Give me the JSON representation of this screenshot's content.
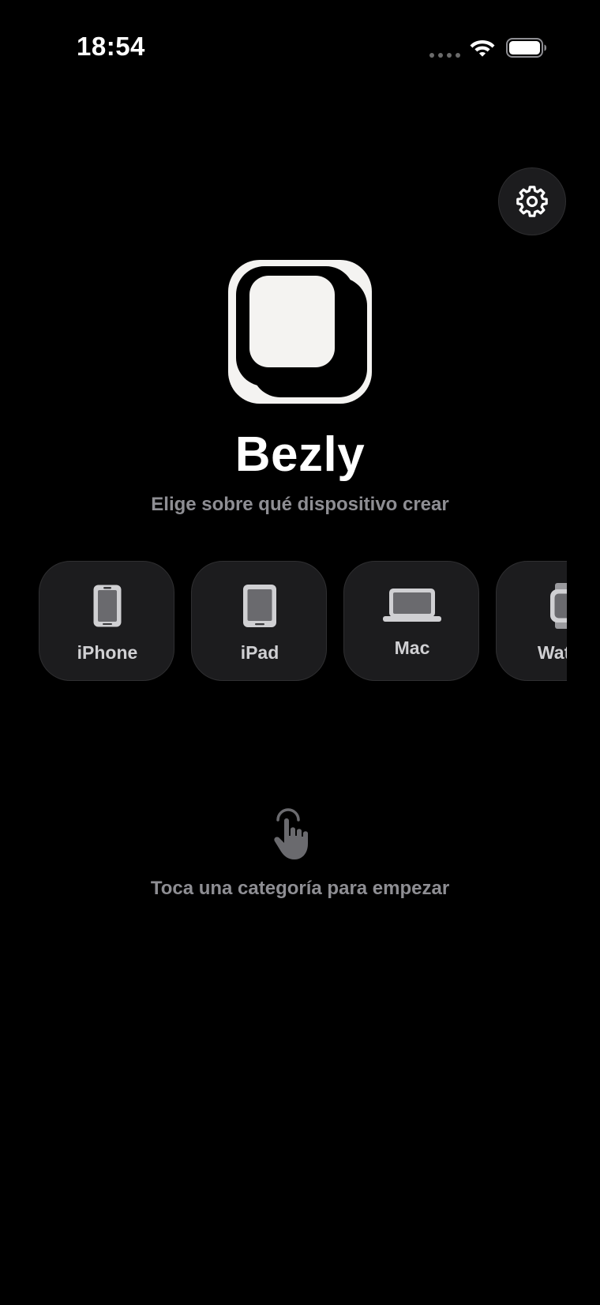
{
  "status_bar": {
    "time": "18:54"
  },
  "header": {
    "settings_icon": "gear-icon"
  },
  "app": {
    "logo_icon": "bezly-logo-icon",
    "title": "Bezly",
    "subtitle": "Elige sobre qué dispositivo crear"
  },
  "categories": [
    {
      "label": "iPhone",
      "icon": "iphone-icon"
    },
    {
      "label": "iPad",
      "icon": "ipad-icon"
    },
    {
      "label": "Mac",
      "icon": "laptop-icon"
    },
    {
      "label": "Watch",
      "icon": "watch-icon"
    }
  ],
  "empty_state": {
    "icon": "hand-tap-icon",
    "message": "Toca una categoría para empezar"
  },
  "colors": {
    "background": "#000000",
    "card": "#1c1c1e",
    "secondary_text": "#8e8e93",
    "icon_gray": "#d0d0d3"
  }
}
